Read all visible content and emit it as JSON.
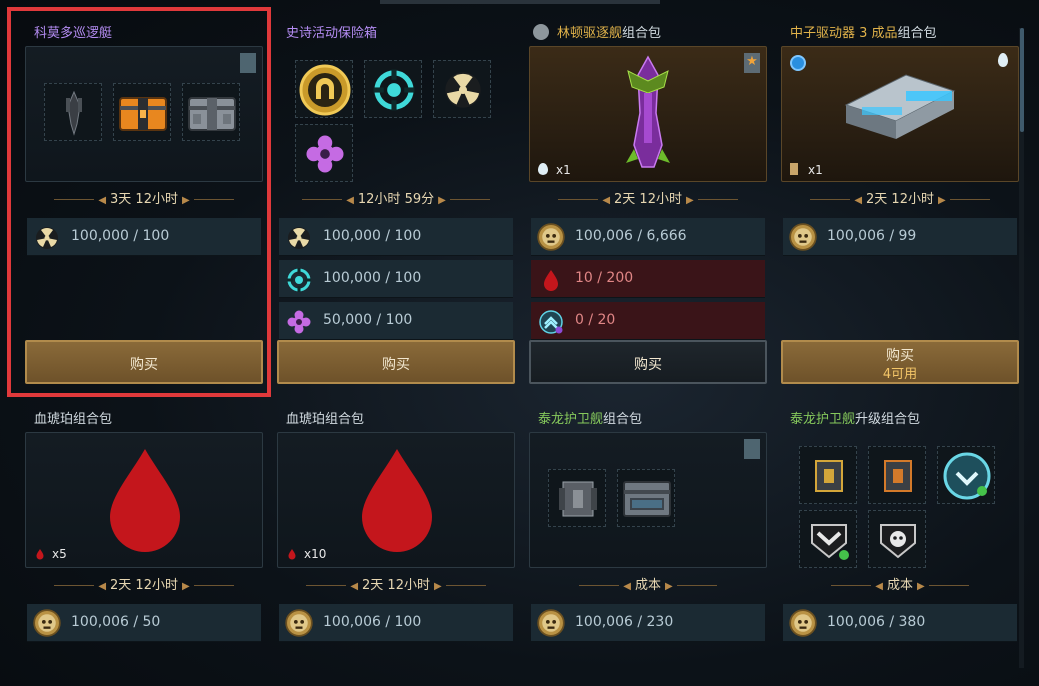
{
  "packs": [
    {
      "title": "科莫多巡逻艇",
      "timer": "3天 12小时",
      "rows": [
        {
          "icon": "radiation-icon",
          "value": "100,000 / 100"
        }
      ],
      "buy": "购买",
      "buy_sub": ""
    },
    {
      "title": "史诗活动保险箱",
      "timer": "12小时 59分",
      "rows": [
        {
          "icon": "radiation-icon",
          "value": "100,000 / 100"
        },
        {
          "icon": "cyan-target-icon",
          "value": "100,000 / 100"
        },
        {
          "icon": "purple-flower-icon",
          "value": "50,000 / 100"
        }
      ],
      "buy": "购买",
      "buy_sub": ""
    },
    {
      "title_prefix": "林顿驱逐舰",
      "title_suffix": "组合包",
      "timer": "2天 12小时",
      "qty": "x1",
      "rows": [
        {
          "icon": "skull-coin-icon",
          "value": "100,006 / 6,666"
        },
        {
          "icon": "blood-drop-icon",
          "value": "10 / 200"
        },
        {
          "icon": "chevron-badge-icon",
          "value": "0 / 20"
        }
      ],
      "buy": "购买",
      "buy_sub": ""
    },
    {
      "title_prefix": "中子驱动器 3 成品",
      "title_suffix": "组合包",
      "timer": "2天 12小时",
      "qty": "x1",
      "rows": [
        {
          "icon": "skull-coin-icon",
          "value": "100,006 / 99"
        }
      ],
      "buy": "购买",
      "buy_sub": "4可用"
    },
    {
      "title": "血琥珀组合包",
      "timer": "2天 12小时",
      "qty": "x5",
      "rows": [
        {
          "icon": "skull-coin-icon",
          "value": "100,006 / 50"
        }
      ]
    },
    {
      "title": "血琥珀组合包",
      "timer": "2天 12小时",
      "qty": "x10",
      "rows": [
        {
          "icon": "skull-coin-icon",
          "value": "100,006 / 100"
        }
      ]
    },
    {
      "title_prefix": "泰龙护卫舰",
      "title_suffix": "组合包",
      "timer": "成本",
      "rows": [
        {
          "icon": "skull-coin-icon",
          "value": "100,006 / 230"
        }
      ]
    },
    {
      "title_prefix": "泰龙护卫舰",
      "title_suffix": "升级组合包",
      "timer": "成本",
      "rows": [
        {
          "icon": "skull-coin-icon",
          "value": "100,006 / 380"
        }
      ]
    }
  ],
  "colors": {
    "accent_gold": "#b18b4c",
    "highlight": "#e0393b",
    "blood": "#c4161c",
    "epic_purple": "#b48cf2",
    "legendary_gold": "#e0b24a",
    "rare_green": "#86c95c"
  }
}
